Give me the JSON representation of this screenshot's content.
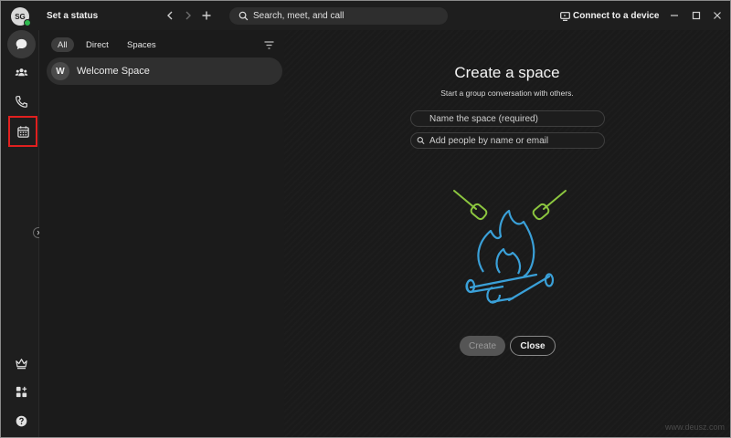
{
  "topbar": {
    "avatar_initials": "SG",
    "status_text": "Set a status",
    "search_placeholder": "Search, meet, and call",
    "connect_label": "Connect to a device"
  },
  "rail": {
    "items": [
      "messaging-icon",
      "teams-icon",
      "calling-icon",
      "meetings-calendar-icon"
    ],
    "bottom_items": [
      "upgrade-crown-icon",
      "apps-icon",
      "help-icon"
    ]
  },
  "list": {
    "filters": [
      "All",
      "Direct",
      "Spaces"
    ],
    "active_filter": "All",
    "spaces": [
      {
        "initial": "W",
        "name": "Welcome Space"
      }
    ]
  },
  "main": {
    "title": "Create a space",
    "subtitle": "Start a group conversation with others.",
    "name_placeholder": "Name the space (required)",
    "people_placeholder": "Add people by name or email",
    "create_label": "Create",
    "close_label": "Close"
  },
  "watermark": "www.deusz.com",
  "colors": {
    "highlight_red": "#e0201f",
    "presence_green": "#2fb94f",
    "flame_blue": "#3aa0d8",
    "marshmallow_green": "#8cc63f"
  }
}
